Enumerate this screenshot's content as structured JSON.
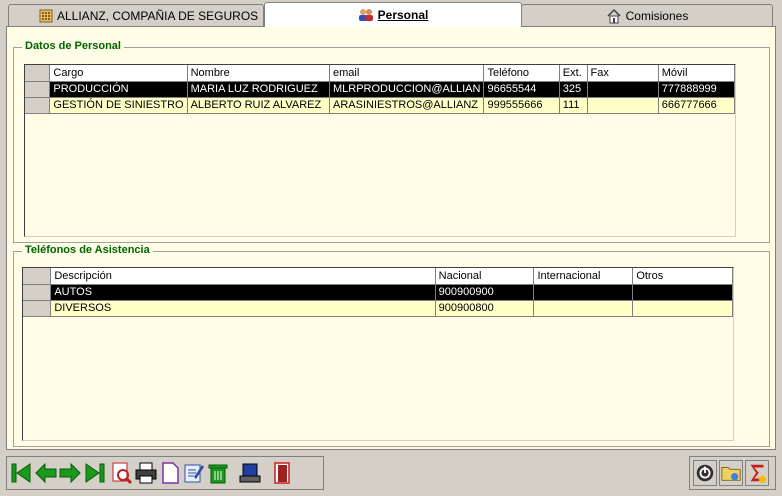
{
  "tabs": [
    {
      "label": "ALLIANZ, COMPAÑIA DE SEGUROS",
      "icon": "building-icon"
    },
    {
      "label": "Personal",
      "icon": "people-icon",
      "active": true
    },
    {
      "label": "Comisiones",
      "icon": "house-icon"
    }
  ],
  "personal": {
    "title": "Datos de Personal",
    "columns": [
      "Cargo",
      "Nombre",
      "email",
      "Teléfono",
      "Ext.",
      "Fax",
      "Móvil"
    ],
    "rows": [
      [
        "PRODUCCIÓN",
        "MARIA LUZ RODRIGUEZ",
        "MLRPRODUCCION@ALLIAN",
        "96655544",
        "325",
        "",
        "777888999"
      ],
      [
        "GESTIÓN DE SINIESTRO",
        "ALBERTO RUIZ ALVAREZ",
        "ARASINIESTROS@ALLIANZ",
        "999555666",
        "111",
        "",
        "666777666"
      ]
    ]
  },
  "asistencia": {
    "title": "Teléfonos de Asistencia",
    "columns": [
      "Descripción",
      "Nacional",
      "Internacional",
      "Otros"
    ],
    "rows": [
      [
        "AUTOS",
        "900900900",
        "",
        ""
      ],
      [
        "DIVERSOS",
        "900900800",
        "",
        ""
      ]
    ]
  },
  "colors": {
    "panel_bg": "#fffde6",
    "row_bg": "#ffffc8",
    "group_title": "#006400",
    "nav_green": "#1a9a1a"
  }
}
